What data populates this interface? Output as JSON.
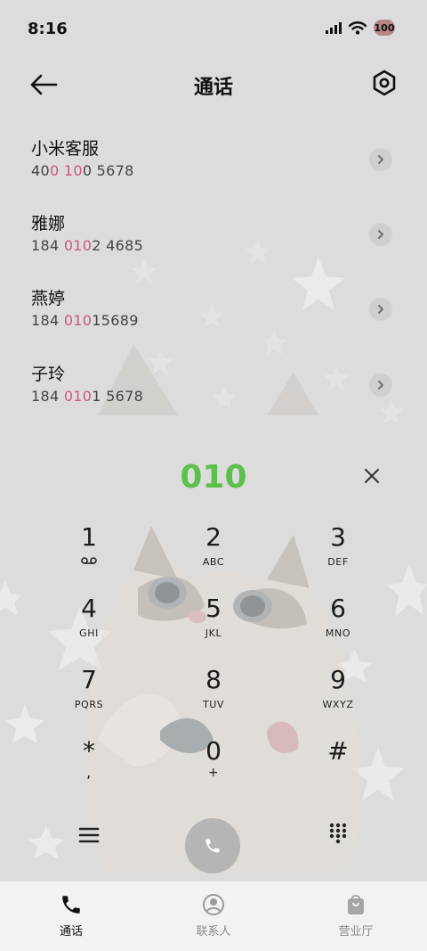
{
  "status_bar": {
    "time": "8:16",
    "battery": "100"
  },
  "header": {
    "title": "通话"
  },
  "contacts": [
    {
      "name": "小米客服",
      "number_parts": [
        "40",
        "0",
        " ",
        "10",
        "0 5678"
      ]
    },
    {
      "name": "雅娜",
      "number_parts": [
        "184 ",
        "010",
        "2 4685"
      ]
    },
    {
      "name": "燕婷",
      "number_parts": [
        "184 ",
        "010",
        "15689"
      ]
    },
    {
      "name": "子玲",
      "number_parts": [
        "184 ",
        "010",
        "1 5678"
      ]
    }
  ],
  "dialer": {
    "input": "010",
    "keys": [
      {
        "num": "1",
        "sub": ""
      },
      {
        "num": "2",
        "sub": "ABC"
      },
      {
        "num": "3",
        "sub": "DEF"
      },
      {
        "num": "4",
        "sub": "GHI"
      },
      {
        "num": "5",
        "sub": "JKL"
      },
      {
        "num": "6",
        "sub": "MNO"
      },
      {
        "num": "7",
        "sub": "PQRS"
      },
      {
        "num": "8",
        "sub": "TUV"
      },
      {
        "num": "9",
        "sub": "WXYZ"
      },
      {
        "num": "*",
        "sub": ","
      },
      {
        "num": "0",
        "sub": "+"
      },
      {
        "num": "#",
        "sub": ""
      }
    ]
  },
  "tabs": [
    {
      "label": "通话",
      "icon": "phone-icon",
      "active": true
    },
    {
      "label": "联系人",
      "icon": "person-icon",
      "active": false
    },
    {
      "label": "营业厅",
      "icon": "bag-icon",
      "active": false
    }
  ],
  "colors": {
    "accent": "#5cc04a",
    "highlight": "#d0577b"
  }
}
